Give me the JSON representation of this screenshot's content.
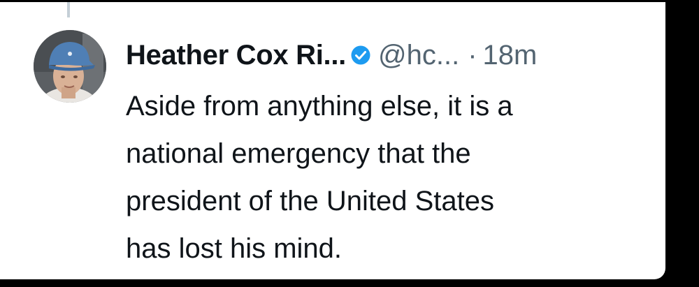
{
  "tweet": {
    "author_name": "Heather Cox Ri...",
    "handle": "@hc...",
    "separator": "·",
    "timestamp": "18m",
    "text_lines": [
      "Aside from anything else, it is a",
      "national emergency that the",
      "president of the United States",
      "has lost his mind."
    ],
    "verified": true,
    "verified_icon": "verified-badge-icon",
    "colors": {
      "name": "#0f1419",
      "secondary": "#536471",
      "verified": "#1d9bf0",
      "card_background": "#ffffff",
      "screen_background": "#000000"
    }
  }
}
